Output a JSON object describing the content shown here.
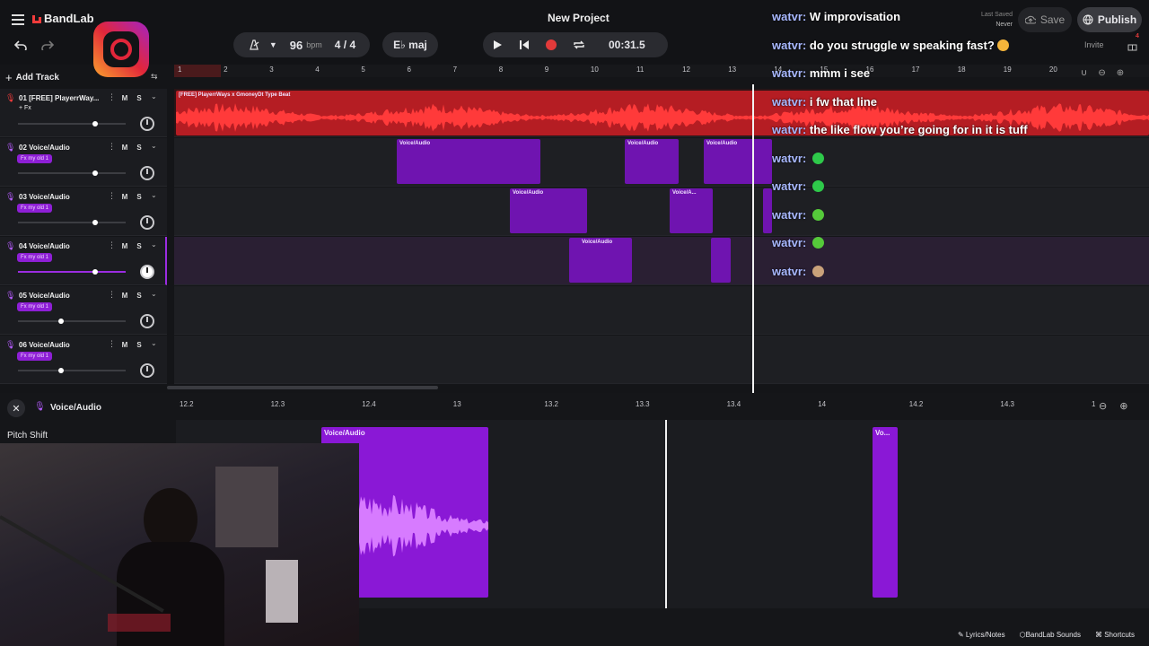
{
  "app": {
    "brand": "BandLab",
    "project_title": "New Project"
  },
  "header": {
    "bpm_value": "96",
    "bpm_unit": "bpm",
    "time_signature": "4 / 4",
    "key": "E♭ maj",
    "time_display": "00:31.5",
    "last_saved_label": "Last Saved",
    "last_saved_value": "Never",
    "save_label": "Save",
    "publish_label": "Publish",
    "invite_label": "Invite",
    "notification_count": "4"
  },
  "tracks_panel": {
    "add_track_label": "Add Track",
    "mute_label": "M",
    "solo_label": "S",
    "tracks": [
      {
        "num": "01",
        "name": "[FREE] PlayerrWay...",
        "fx": "+ Fx",
        "volume": 0.72,
        "active": false
      },
      {
        "num": "02",
        "name": "Voice/Audio",
        "fx": "Fx my old 1",
        "volume": 0.72,
        "active": false
      },
      {
        "num": "03",
        "name": "Voice/Audio",
        "fx": "Fx my old 1",
        "volume": 0.72,
        "active": false
      },
      {
        "num": "04",
        "name": "Voice/Audio",
        "fx": "Fx my old 1",
        "volume": 0.72,
        "active": true
      },
      {
        "num": "05",
        "name": "Voice/Audio",
        "fx": "Fx my old 1",
        "volume": 0.4,
        "active": false
      },
      {
        "num": "06",
        "name": "Voice/Audio",
        "fx": "Fx my old 1",
        "volume": 0.4,
        "active": false
      }
    ]
  },
  "timeline": {
    "ruler": [
      "1",
      "2",
      "3",
      "4",
      "5",
      "6",
      "7",
      "8",
      "9",
      "10",
      "11",
      "12",
      "13",
      "14",
      "15",
      "16",
      "17",
      "18",
      "19",
      "20"
    ],
    "beat_clip_label": "[FREE] PlayerrWays x GmoneyDt Type Beat",
    "clip_label": "Voice/Audio",
    "clip_label_short": "Voice/A..."
  },
  "chat": {
    "username": "watvr:",
    "messages": [
      "W improvisation",
      "do you struggle w speaking fast?",
      "mmm i see",
      "i fw that line",
      "the like flow you’re going for in it is tuff",
      "",
      "",
      "",
      "",
      ""
    ],
    "emote_colors": [
      "#f4b43a",
      "#2ec94a",
      "#2ec94a",
      "#55c93a",
      "#55c93a",
      "#c9a27a"
    ]
  },
  "editor": {
    "track_label": "Voice/Audio",
    "pitch_shift_label": "Pitch Shift",
    "ruler": [
      "12.2",
      "12.3",
      "12.4",
      "13",
      "13.2",
      "13.3",
      "13.4",
      "14",
      "14.2",
      "14.3",
      "1"
    ],
    "clip_label": "Voice/Audio",
    "clip_label_short": "Vo..."
  },
  "footer": {
    "lyrics_label": "Lyrics/Notes",
    "sounds_label": "BandLab Sounds",
    "shortcuts_label": "Shortcuts"
  },
  "colors": {
    "accent_red": "#e0262b",
    "clip_purple": "#8e1fd6",
    "record_red": "#e23a3a"
  }
}
